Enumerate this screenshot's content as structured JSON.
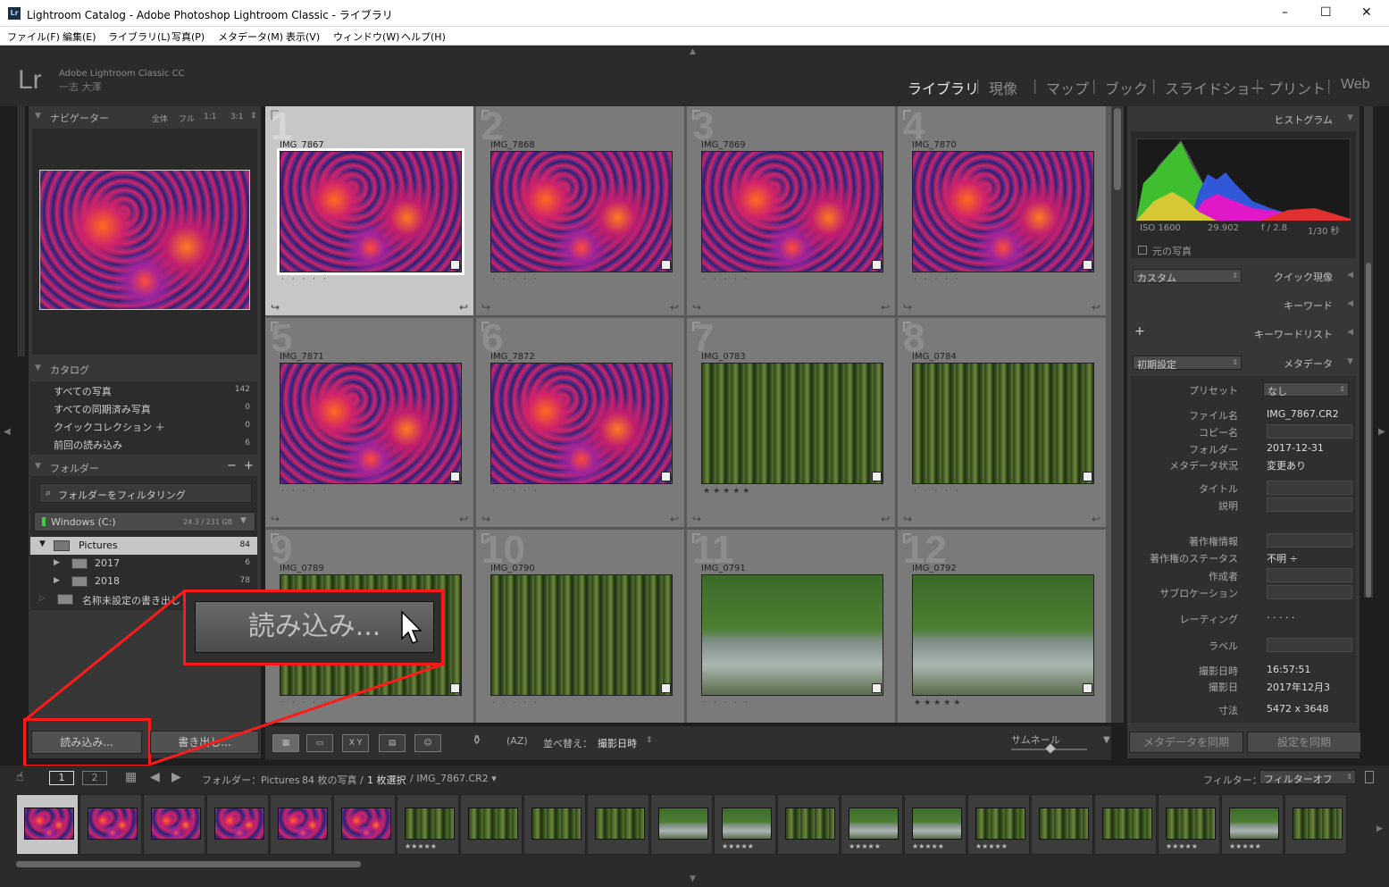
{
  "window": {
    "title": "Lightroom Catalog - Adobe Photoshop Lightroom Classic - ライブラリ",
    "app_icon": "Lr",
    "minimize": "–",
    "maximize": "☐",
    "close": "✕"
  },
  "menu": [
    "ファイル(F)",
    "編集(E)",
    "ライブラリ(L)",
    "写真(P)",
    "メタデータ(M)",
    "表示(V)",
    "ウィンドウ(W)",
    "ヘルプ(H)"
  ],
  "identity": {
    "logo": "Lr",
    "product": "Adobe Lightroom Classic CC",
    "user": "一志 大澤"
  },
  "modules": [
    "ライブラリ",
    "現像",
    "マップ",
    "ブック",
    "スライドショー",
    "プリント",
    "Web"
  ],
  "left": {
    "navigator": {
      "title": "ナビゲーター",
      "zoom": [
        "全体",
        "フル",
        "1:1",
        "3:1"
      ]
    },
    "catalog": {
      "title": "カタログ",
      "items": [
        {
          "label": "すべての写真",
          "count": "142"
        },
        {
          "label": "すべての同期済み写真",
          "count": "0"
        },
        {
          "label": "クイックコレクション ＋",
          "count": "0"
        },
        {
          "label": "前回の読み込み",
          "count": "6"
        }
      ]
    },
    "folders": {
      "title": "フォルダー",
      "filter_placeholder": "フォルダーをフィルタリング",
      "volume": "Windows (C:)",
      "volume_size": "24.3 / 231 GB",
      "items": [
        {
          "label": "Pictures",
          "count": "84"
        },
        {
          "label": "2017",
          "count": "6"
        },
        {
          "label": "2018",
          "count": "78"
        },
        {
          "label": "名称未設定の書き出し",
          "count": ""
        }
      ]
    },
    "import": "読み込み...",
    "export": "書き出し..."
  },
  "grid": {
    "cells": [
      {
        "num": "1",
        "name": "IMG_7867",
        "kind": "fire",
        "stars": "· · · · ·"
      },
      {
        "num": "2",
        "name": "IMG_7868",
        "kind": "fire",
        "stars": "· · · · ·"
      },
      {
        "num": "3",
        "name": "IMG_7869",
        "kind": "fire",
        "stars": "· · · · ·"
      },
      {
        "num": "4",
        "name": "IMG_7870",
        "kind": "fire",
        "stars": "· · · · ·"
      },
      {
        "num": "5",
        "name": "IMG_7871",
        "kind": "fire",
        "stars": "· · · · ·"
      },
      {
        "num": "6",
        "name": "IMG_7872",
        "kind": "fire",
        "stars": "· · · · ·"
      },
      {
        "num": "7",
        "name": "IMG_0783",
        "kind": "forest",
        "stars": "★★★★★"
      },
      {
        "num": "8",
        "name": "IMG_0784",
        "kind": "forest",
        "stars": "· · · · ·"
      },
      {
        "num": "9",
        "name": "IMG_0789",
        "kind": "forest",
        "stars": "· · · · ·"
      },
      {
        "num": "10",
        "name": "IMG_0790",
        "kind": "forest",
        "stars": "· · · · ·"
      },
      {
        "num": "11",
        "name": "IMG_0791",
        "kind": "water",
        "stars": "· · · · ·"
      },
      {
        "num": "12",
        "name": "IMG_0792",
        "kind": "water",
        "stars": "★★★★★"
      }
    ]
  },
  "toolbar": {
    "sort_label": "並べ替え：",
    "sort_value": "撮影日時",
    "thumb_label": "サムネール"
  },
  "right": {
    "histogram": {
      "title": "ヒストグラム",
      "iso": "ISO 1600",
      "focal": "29.902",
      "aperture": "f / 2.8",
      "shutter": "1/30 秒",
      "original": "元の写真"
    },
    "quick_develop": {
      "preset": "カスタム",
      "title": "クイック現像"
    },
    "keywording": "キーワード",
    "keyword_list": "キーワードリスト",
    "metadata": {
      "preset": "初期設定",
      "title": "メタデータ",
      "preset_label": "プリセット",
      "preset_value": "なし",
      "fields": [
        {
          "k": "ファイル名",
          "v": "IMG_7867.CR2"
        },
        {
          "k": "コピー名",
          "v": ""
        },
        {
          "k": "フォルダー",
          "v": "2017-12-31"
        },
        {
          "k": "メタデータ状況",
          "v": "変更あり"
        },
        {
          "k": "タイトル",
          "v": ""
        },
        {
          "k": "説明",
          "v": ""
        },
        {
          "k": "著作権情報",
          "v": ""
        },
        {
          "k": "著作権のステータス",
          "v": "不明 ÷"
        },
        {
          "k": "作成者",
          "v": ""
        },
        {
          "k": "サブロケーション",
          "v": ""
        },
        {
          "k": "レーティング",
          "v": "· · · · ·"
        },
        {
          "k": "ラベル",
          "v": ""
        },
        {
          "k": "撮影日時",
          "v": "16:57:51"
        },
        {
          "k": "撮影日",
          "v": "2017年12月3"
        },
        {
          "k": "寸法",
          "v": "5472 x 3648"
        }
      ]
    },
    "sync_meta": "メタデータを同期",
    "sync_settings": "設定を同期"
  },
  "filmbar": {
    "page1": "1",
    "page2": "2",
    "path_prefix": "フォルダー：Pictures",
    "count": "84 枚の写真 /",
    "selected": "1 枚選択",
    "file": "/ IMG_7867.CR2 ▾",
    "filter_label": "フィルター：",
    "filter_value": "フィルターオフ"
  },
  "callout": {
    "label": "読み込み..."
  }
}
